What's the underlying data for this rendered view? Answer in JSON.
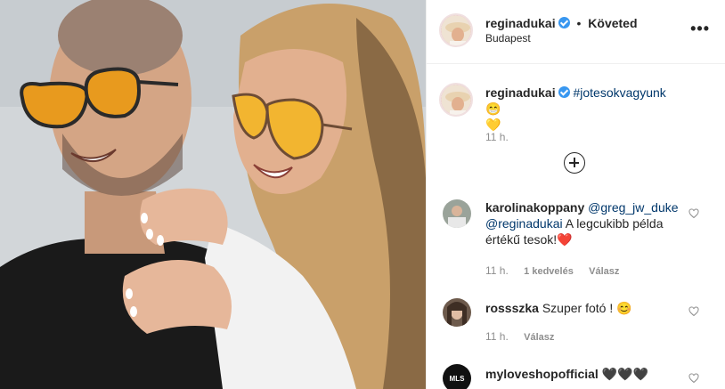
{
  "post": {
    "username": "reginadukai",
    "follow_status": "Követed",
    "separator": "•",
    "location": "Budapest",
    "more_icon": "•••",
    "image_alt": "Two people wearing orange-tinted aviator sunglasses"
  },
  "caption": {
    "username": "reginadukai",
    "hashtag": "#jotesokvagyunk",
    "emojis": "😁",
    "heart_emoji": "💛",
    "time": "11 h."
  },
  "comments": [
    {
      "username": "karolinakoppany",
      "mention1": "@greg_jw_duke",
      "mention2": "@reginadukai",
      "text": "A legcukibb példa értékű tesok!",
      "emoji": "❤️",
      "time": "11 h.",
      "likes": "1 kedvelés",
      "reply": "Válasz"
    },
    {
      "username": "rossszka",
      "text": "Szuper fotó !",
      "emoji": "😊",
      "time": "11 h.",
      "reply": "Válasz"
    },
    {
      "username": "myloveshopofficial",
      "text": "🖤🖤🖤",
      "avatar_text": "MLS"
    }
  ],
  "colors": {
    "link": "#00376b",
    "verified": "#3897f0",
    "muted": "#8e8e8e",
    "border": "#efefef"
  }
}
